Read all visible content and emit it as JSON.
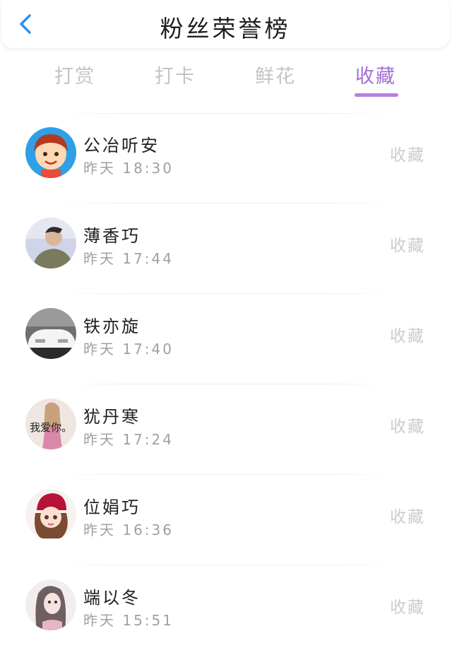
{
  "header": {
    "title": "粉丝荣誉榜",
    "back_icon": "chevron-left-icon",
    "accent": "#2f8ff0"
  },
  "tabs": [
    {
      "label": "打赏",
      "active": false
    },
    {
      "label": "打卡",
      "active": false
    },
    {
      "label": "鲜花",
      "active": false
    },
    {
      "label": "收藏",
      "active": true
    }
  ],
  "colors": {
    "active_tab": "#a46fd3",
    "inactive_tab": "#c4c4c4"
  },
  "list": [
    {
      "name": "公冶听安",
      "time": "昨天 18:30",
      "action": "收藏",
      "avatar": "cartoon-boy-avatar"
    },
    {
      "name": "薄香巧",
      "time": "昨天 17:44",
      "action": "收藏",
      "avatar": "young-man-avatar"
    },
    {
      "name": "铁亦旋",
      "time": "昨天 17:40",
      "action": "收藏",
      "avatar": "white-car-avatar"
    },
    {
      "name": "犹丹寒",
      "time": "昨天 17:24",
      "action": "收藏",
      "avatar": "girl-photo-avatar",
      "avatar_text": "我爱你。"
    },
    {
      "name": "位娟巧",
      "time": "昨天 16:36",
      "action": "收藏",
      "avatar": "anime-girl-red-hat-avatar"
    },
    {
      "name": "端以冬",
      "time": "昨天 15:51",
      "action": "收藏",
      "avatar": "sketch-girl-avatar"
    }
  ]
}
